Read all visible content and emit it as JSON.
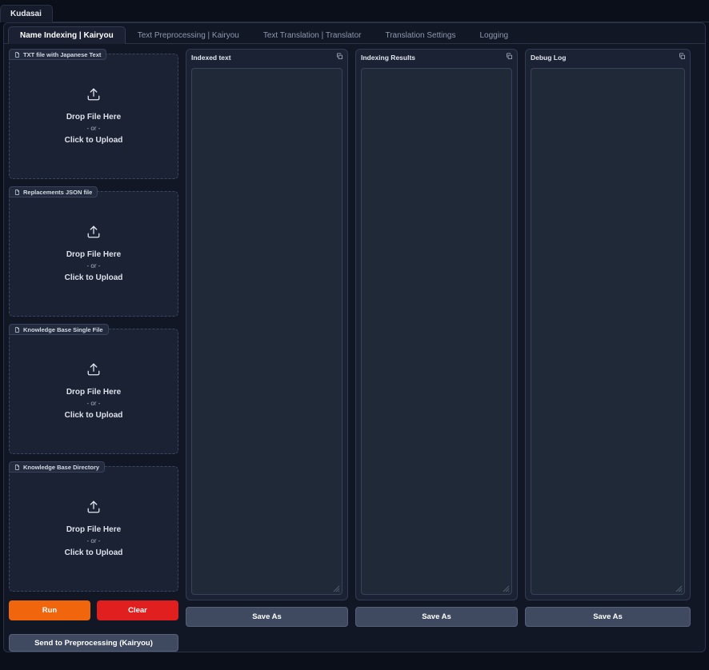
{
  "window": {
    "app_tab_label": "Kudasai"
  },
  "tabs": {
    "items": [
      {
        "label": "Name Indexing | Kairyou",
        "active": true
      },
      {
        "label": "Text Preprocessing | Kairyou",
        "active": false
      },
      {
        "label": "Text Translation | Translator",
        "active": false
      },
      {
        "label": "Translation Settings",
        "active": false
      },
      {
        "label": "Logging",
        "active": false
      }
    ]
  },
  "uploads": {
    "drop_main": "Drop File Here",
    "drop_or": "- or -",
    "drop_click": "Click to Upload",
    "items": [
      {
        "label": "TXT file with Japanese Text",
        "icon": "file-icon"
      },
      {
        "label": "Replacements JSON file",
        "icon": "file-icon"
      },
      {
        "label": "Knowledge Base Single File",
        "icon": "file-icon"
      },
      {
        "label": "Knowledge Base Directory",
        "icon": "file-icon"
      }
    ]
  },
  "actions": {
    "run_label": "Run",
    "clear_label": "Clear",
    "send_label": "Send to Preprocessing (Kairyou)",
    "run_color": "#f1650d",
    "clear_color": "#e11f1f",
    "neutral_color": "#3f4a61"
  },
  "panels": [
    {
      "title": "Indexed text",
      "value": "",
      "copy_icon": "copy-icon",
      "save_label": "Save As"
    },
    {
      "title": "Indexing Results",
      "value": "",
      "copy_icon": "copy-icon",
      "save_label": "Save As"
    },
    {
      "title": "Debug Log",
      "value": "",
      "copy_icon": "copy-icon",
      "save_label": "Save As"
    }
  ],
  "theme": {
    "page_bg": "#0b0f19",
    "panel_bg": "#1b2234",
    "field_bg": "#202938",
    "border": "#313b52",
    "text": "#e2e6ef",
    "muted": "#8e98ad"
  }
}
